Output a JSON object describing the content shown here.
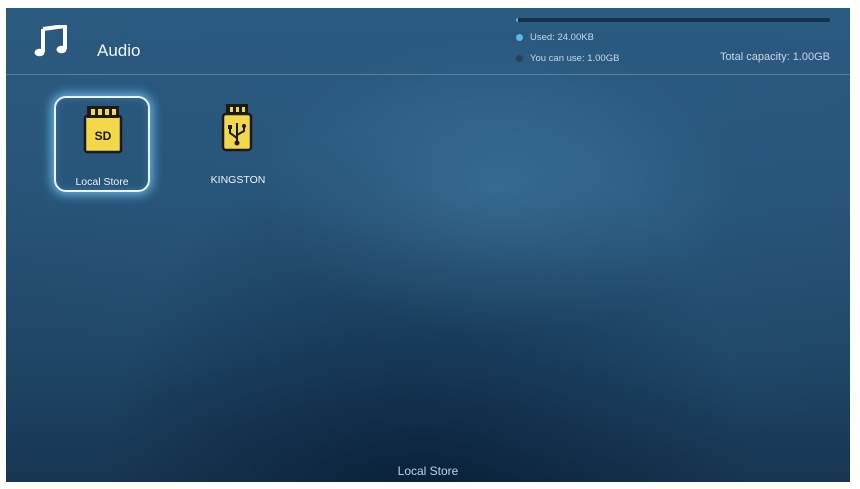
{
  "header": {
    "title": "Audio",
    "icon": "music-note-icon"
  },
  "storage": {
    "used_fraction": 2e-05,
    "used_label": "Used: 24.00KB",
    "free_label": "You can use: 1.00GB",
    "total_label": "Total capacity: 1.00GB",
    "colors": {
      "used": "#59b9ea",
      "free": "#27415a"
    }
  },
  "drives": [
    {
      "label": "Local Store",
      "icon": "sd-card-icon",
      "icon_text": "SD",
      "selected": true
    },
    {
      "label": "KINGSTON",
      "icon": "usb-drive-icon",
      "selected": false
    }
  ],
  "footer": {
    "current_location": "Local Store"
  },
  "colors": {
    "accent": "#f3d84a",
    "focus_glow": "#78cdff",
    "background": "#285478"
  }
}
